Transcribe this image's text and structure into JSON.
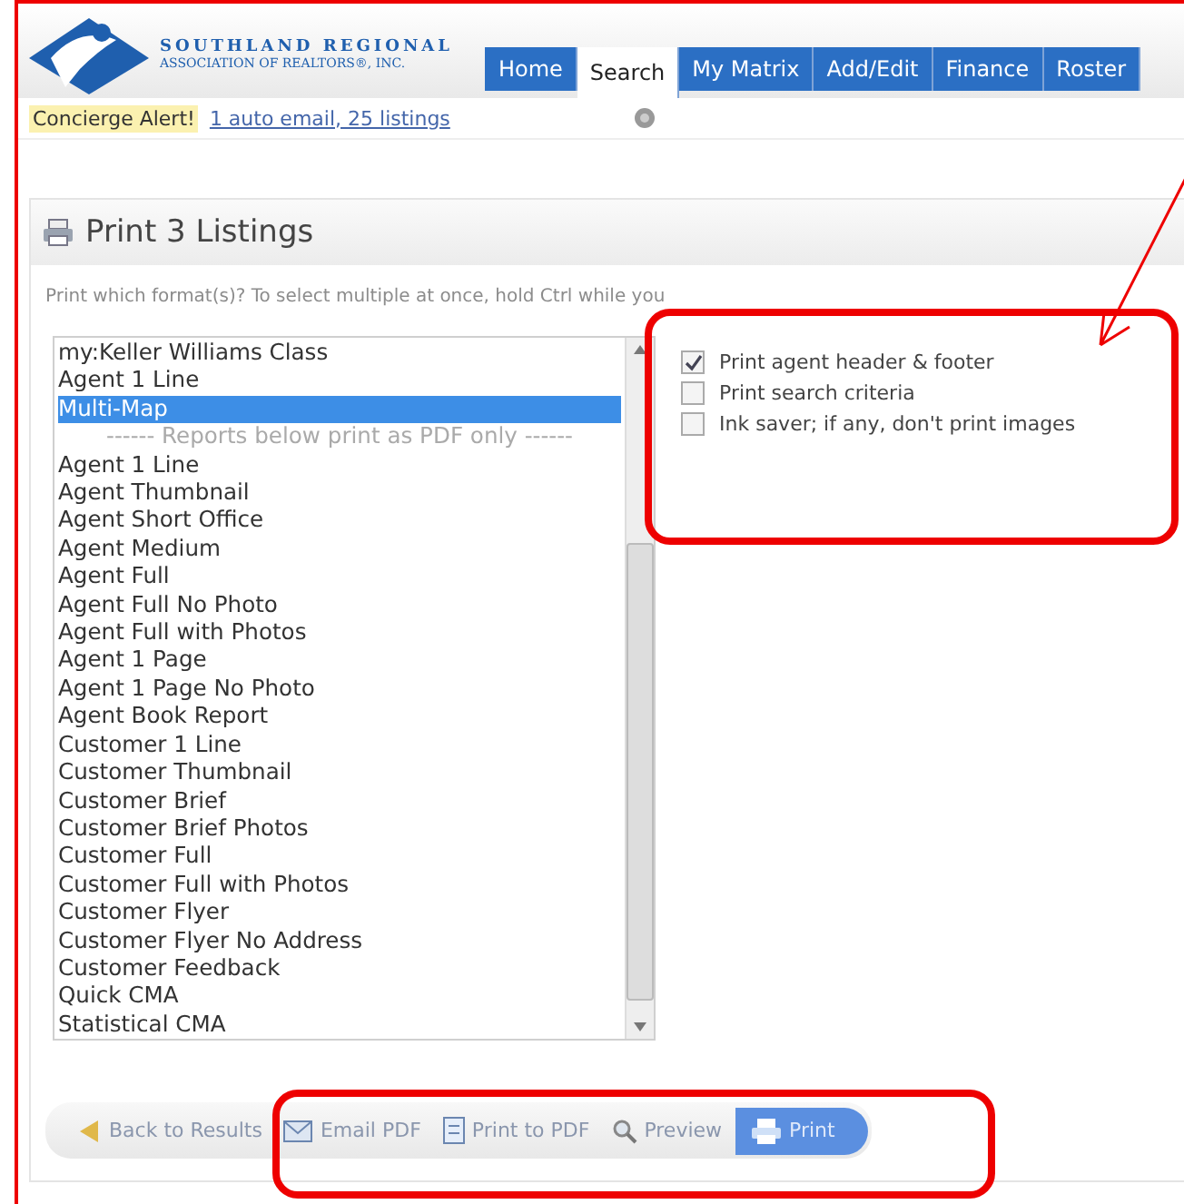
{
  "header": {
    "logo_line1": "SOUTHLAND REGIONAL",
    "logo_line2": "ASSOCIATION OF REALTORS®, INC.",
    "tabs": [
      {
        "label": "Home",
        "selected": false
      },
      {
        "label": "Search",
        "selected": true
      },
      {
        "label": "My Matrix",
        "selected": false
      },
      {
        "label": "Add/Edit",
        "selected": false
      },
      {
        "label": "Finance",
        "selected": false
      },
      {
        "label": "Roster",
        "selected": false
      }
    ]
  },
  "alert": {
    "label": "Concierge Alert!",
    "link": "1 auto email, 25 listings"
  },
  "panel": {
    "title": "Print 3 Listings",
    "instructions": "Print which format(s)? To select multiple at once, hold Ctrl while you",
    "formats": [
      {
        "label": "my:Keller Williams Class",
        "kind": "option",
        "selected": false
      },
      {
        "label": "Agent 1 Line",
        "kind": "option",
        "selected": false
      },
      {
        "label": "Multi-Map",
        "kind": "option",
        "selected": true
      },
      {
        "label": "------ Reports below print as PDF only ------",
        "kind": "separator",
        "selected": false
      },
      {
        "label": "Agent 1 Line",
        "kind": "option",
        "selected": false
      },
      {
        "label": "Agent Thumbnail",
        "kind": "option",
        "selected": false
      },
      {
        "label": "Agent Short Office",
        "kind": "option",
        "selected": false
      },
      {
        "label": "Agent Medium",
        "kind": "option",
        "selected": false
      },
      {
        "label": "Agent Full",
        "kind": "option",
        "selected": false
      },
      {
        "label": "Agent Full No Photo",
        "kind": "option",
        "selected": false
      },
      {
        "label": "Agent Full with Photos",
        "kind": "option",
        "selected": false
      },
      {
        "label": "Agent 1 Page",
        "kind": "option",
        "selected": false
      },
      {
        "label": "Agent 1 Page No Photo",
        "kind": "option",
        "selected": false
      },
      {
        "label": "Agent Book Report",
        "kind": "option",
        "selected": false
      },
      {
        "label": "Customer 1 Line",
        "kind": "option",
        "selected": false
      },
      {
        "label": "Customer Thumbnail",
        "kind": "option",
        "selected": false
      },
      {
        "label": "Customer Brief",
        "kind": "option",
        "selected": false
      },
      {
        "label": "Customer Brief Photos",
        "kind": "option",
        "selected": false
      },
      {
        "label": "Customer Full",
        "kind": "option",
        "selected": false
      },
      {
        "label": "Customer Full with Photos",
        "kind": "option",
        "selected": false
      },
      {
        "label": "Customer Flyer",
        "kind": "option",
        "selected": false
      },
      {
        "label": "Customer Flyer No Address",
        "kind": "option",
        "selected": false
      },
      {
        "label": "Customer Feedback",
        "kind": "option",
        "selected": false
      },
      {
        "label": "Quick CMA",
        "kind": "option",
        "selected": false
      },
      {
        "label": "Statistical CMA",
        "kind": "option",
        "selected": false
      }
    ],
    "options": [
      {
        "label": "Print agent header & footer",
        "checked": true
      },
      {
        "label": "Print search criteria",
        "checked": false
      },
      {
        "label": "Ink saver; if any, don't print images",
        "checked": false
      }
    ]
  },
  "toolbar": [
    {
      "label": "Back to Results",
      "kind": "back"
    },
    {
      "label": "Email PDF",
      "kind": "email"
    },
    {
      "label": "Print to PDF",
      "kind": "pdf"
    },
    {
      "label": "Preview",
      "kind": "preview"
    },
    {
      "label": "Print",
      "kind": "print"
    }
  ]
}
